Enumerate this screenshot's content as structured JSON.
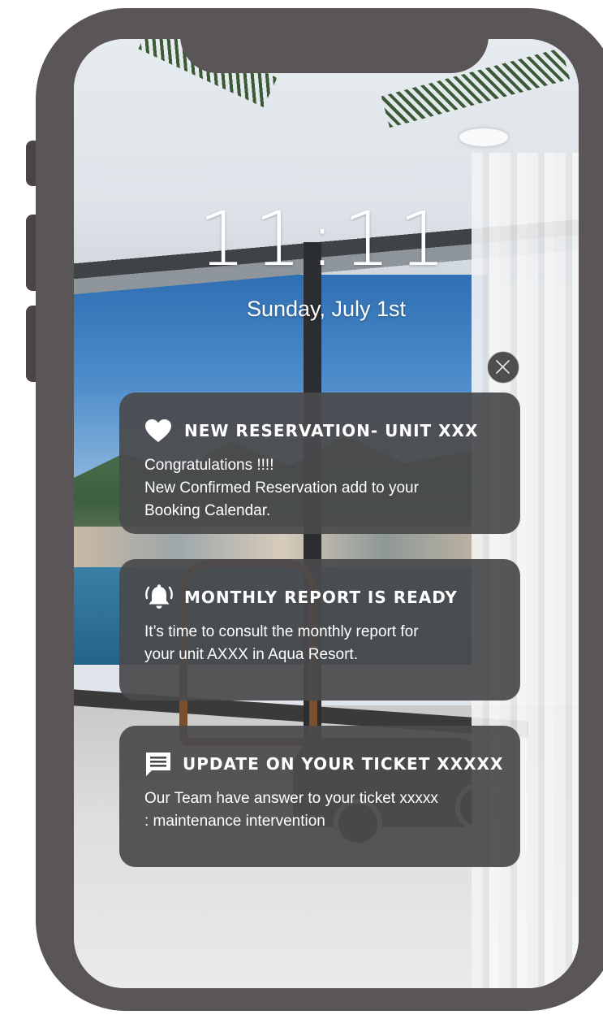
{
  "lock_screen": {
    "time": "11:11",
    "date": "Sunday, July 1st"
  },
  "close_button": {
    "icon": "close-icon"
  },
  "notifications": [
    {
      "icon": "heart-icon",
      "title": "NEW RESERVATION- UNIT XXX",
      "lines": [
        "Congratulations !!!!",
        "New Confirmed Reservation add to your",
        "Booking Calendar."
      ]
    },
    {
      "icon": "bell-icon",
      "title": "MONTHLY REPORT IS READY",
      "lines": [
        "It’s time to consult the monthly report for",
        "your unit AXXX in Aqua Resort."
      ]
    },
    {
      "icon": "message-icon",
      "title": "UPDATE ON YOUR TICKET XXXXX",
      "lines": [
        "Our Team have answer to your ticket xxxxx",
        ": maintenance intervention"
      ]
    }
  ],
  "colors": {
    "phone_frame": "#5a5556",
    "card_background": "#4a4a4c",
    "text": "#ffffff"
  }
}
